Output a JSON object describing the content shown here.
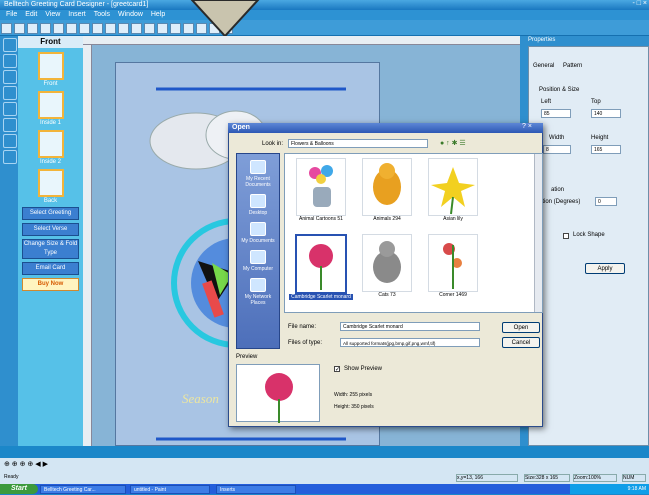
{
  "titlebar": {
    "title": "Belltech Greeting Card Designer - [greetcard1]",
    "controls": "- □ ×"
  },
  "menubar": {
    "items": [
      "File",
      "Edit",
      "View",
      "Insert",
      "Tools",
      "Window",
      "Help"
    ]
  },
  "pages_panel": {
    "title": "Front",
    "thumbs": [
      "Front",
      "Inside 1",
      "Inside 2",
      "Back"
    ],
    "buttons": [
      "Select Greeting",
      "Select Verse",
      "Change Size & Fold Type",
      "Email Card",
      "Buy Now"
    ]
  },
  "card": {
    "text": "Season"
  },
  "properties": {
    "title": "Properties",
    "tabs": [
      "General",
      "Pattern"
    ],
    "section_position": "Position & Size",
    "left_label": "Left",
    "left_value": "85",
    "top_label": "Top",
    "top_value": "140",
    "width_label": "Width",
    "width_value": "8",
    "height_label": "Height",
    "height_value": "165",
    "rotation_label": "ation",
    "rotation_field_label": "ation (Degrees)",
    "rotation_value": "0",
    "lock_label": "Lock Shape",
    "apply_label": "Apply"
  },
  "dialog": {
    "title": "Open",
    "title_controls": "? ×",
    "look_in_label": "Look in:",
    "look_in_value": "Flowers & Balloons",
    "places": [
      "My Recent Documents",
      "Desktop",
      "My Documents",
      "My Computer",
      "My Network Places"
    ],
    "files": [
      {
        "name": "Animal Cartoons 51",
        "selected": false
      },
      {
        "name": "Animals 294",
        "selected": false
      },
      {
        "name": "Asian lily",
        "selected": false
      },
      {
        "name": "Cambridge Scarlet monard",
        "selected": true
      },
      {
        "name": "Cats 73",
        "selected": false
      },
      {
        "name": "Corner 1469",
        "selected": false
      }
    ],
    "filename_label": "File name:",
    "filename_value": "Cambridge Scarlet monard",
    "filetype_label": "Files of type:",
    "filetype_value": "All supported formats(jpg,bmp,gif,png,wmf,tif)",
    "open_label": "Open",
    "cancel_label": "Cancel",
    "preview_label": "Preview",
    "show_preview_label": "Show Preview",
    "width_text": "Width: 255 pixels",
    "height_text": "Height: 350 pixels"
  },
  "statusbar": {
    "ready": "Ready",
    "coords": "x,y=13, 166",
    "size": "Size:328 x 165",
    "zoom": "Zoom:100%",
    "num": "NUM"
  },
  "taskbar": {
    "start": "Start",
    "tasks": [
      "Belltech Greeting Car...",
      "untitled - Paint",
      "Inserts"
    ],
    "clock": "9:18 AM"
  }
}
